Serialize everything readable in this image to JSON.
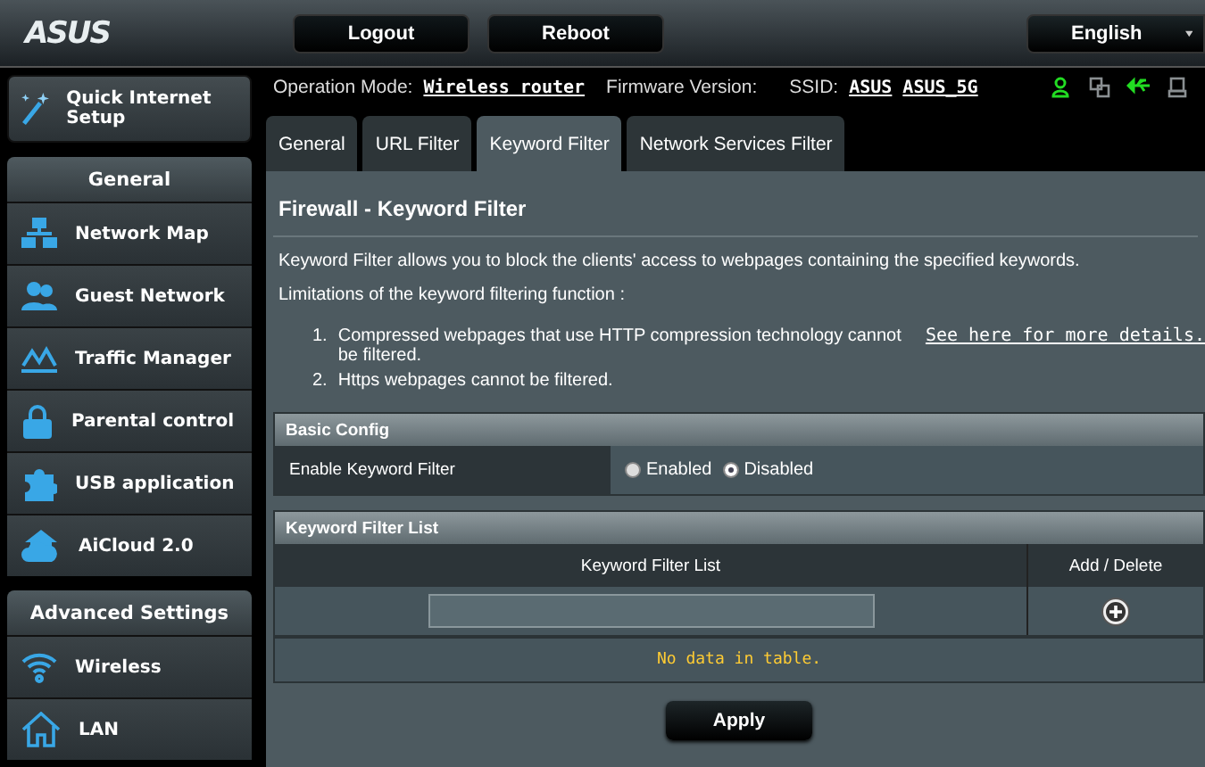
{
  "header": {
    "logo": "ASUS",
    "buttons": [
      "Logout",
      "Reboot"
    ],
    "language": "English"
  },
  "status": {
    "mode_label": "Operation Mode:",
    "mode": "Wireless router",
    "firmware_label": "Firmware Version:",
    "ssid_label": "SSID:",
    "ssids": [
      "ASUS",
      "ASUS_5G"
    ],
    "icons": [
      {
        "kind": "clients",
        "on": true
      },
      {
        "kind": "network",
        "on": false
      },
      {
        "kind": "usb",
        "on": true
      },
      {
        "kind": "printer",
        "on": false
      }
    ]
  },
  "sidebar": {
    "quick_setup": "Quick Internet Setup",
    "sections": [
      {
        "title": "General",
        "items": [
          {
            "label": "Network Map",
            "kind": "map",
            "selected": false
          },
          {
            "label": "Guest Network",
            "kind": "guests",
            "selected": false
          },
          {
            "label": "Traffic Manager",
            "kind": "traffic",
            "selected": false
          },
          {
            "label": "Parental control",
            "kind": "lock",
            "selected": false
          },
          {
            "label": "USB application",
            "kind": "puzzle",
            "selected": false
          },
          {
            "label": "AiCloud 2.0",
            "kind": "cloud",
            "selected": false
          }
        ]
      },
      {
        "title": "Advanced Settings",
        "items": [
          {
            "label": "Wireless",
            "kind": "wifi",
            "selected": false
          },
          {
            "label": "LAN",
            "kind": "home",
            "selected": false
          }
        ]
      }
    ]
  },
  "tabs": [
    {
      "label": "General",
      "selected": false
    },
    {
      "label": "URL Filter",
      "selected": false
    },
    {
      "label": "Keyword Filter",
      "selected": true
    },
    {
      "label": "Network Services Filter",
      "selected": false
    }
  ],
  "page": {
    "title": "Firewall - Keyword Filter",
    "intro": "Keyword Filter allows you to block the clients' access to webpages containing the specified keywords.",
    "limits_title": "Limitations of the keyword filtering function :",
    "limits": [
      {
        "number": "1.",
        "text": "Compressed webpages that use HTTP compression technology cannot be filtered.",
        "link": "See here for more details."
      },
      {
        "number": "2.",
        "text": "Https webpages cannot be filtered."
      }
    ]
  },
  "basic_config": {
    "title": "Basic Config",
    "label": "Enable Keyword Filter",
    "options": [
      {
        "label": "Enabled",
        "selected": false
      },
      {
        "label": "Disabled",
        "selected": true
      }
    ]
  },
  "keyword_list": {
    "title": "Keyword Filter List",
    "columns": [
      "Keyword Filter List",
      "Add / Delete"
    ],
    "empty": "No data in table."
  },
  "apply": "Apply"
}
